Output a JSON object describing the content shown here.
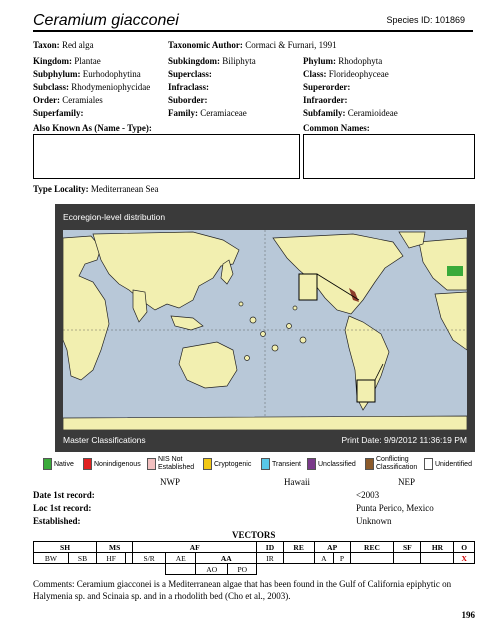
{
  "header": {
    "title": "Ceramium giacconei",
    "species_id": "Species ID: 101869"
  },
  "taxon": {
    "taxon_label": "Taxon:",
    "taxon_value": "Red alga",
    "author_label": "Taxonomic Author:",
    "author_value": "Cormaci & Furnari, 1991"
  },
  "classification": {
    "kingdom_label": "Kingdom:",
    "kingdom_value": "Plantae",
    "subkingdom_label": "Subkingdom:",
    "subkingdom_value": "Biliphyta",
    "phylum_label": "Phylum:",
    "phylum_value": "Rhodophyta",
    "subphylum_label": "Subphylum:",
    "subphylum_value": "Eurhodophytina",
    "superclass_label": "Superclass:",
    "superclass_value": "",
    "class_label": "Class:",
    "class_value": "Florideophyceae",
    "subclass_label": "Subclass:",
    "subclass_value": "Rhodymeniophycidae",
    "infraclass_label": "Infraclass:",
    "infraclass_value": "",
    "superorder_label": "Superorder:",
    "superorder_value": "",
    "order_label": "Order:",
    "order_value": "Ceramiales",
    "suborder_label": "Suborder:",
    "suborder_value": "",
    "infraorder_label": "Infraorder:",
    "infraorder_value": "",
    "superfamily_label": "Superfamily:",
    "superfamily_value": "",
    "family_label": "Family:",
    "family_value": "Ceramiaceae",
    "subfamily_label": "Subfamily:",
    "subfamily_value": "Ceramioideae"
  },
  "names": {
    "aka_label": "Also Known As (Name - Type):",
    "common_label": "Common Names:"
  },
  "type_locality": {
    "label": "Type Locality:",
    "value": "Mediterranean Sea"
  },
  "map": {
    "heading": "Ecoregion-level distribution",
    "footer_left": "Master Classifications",
    "footer_right": "Print Date: 9/9/2012 11:36:19 PM",
    "colors": {
      "frame": "#3a3a3a",
      "ocean": "#b8c8d8",
      "land": "#f2efb0",
      "highlight": "#8b3d2a",
      "native": "#3aaa3a"
    }
  },
  "legend": [
    {
      "label": "Native",
      "color": "#3aaa3a"
    },
    {
      "label": "Nonindigenous",
      "color": "#e02020"
    },
    {
      "label": "NIS Not",
      "label2": "Established",
      "color": "#f2c0c0"
    },
    {
      "label": "Cryptogenic",
      "color": "#f2c814"
    },
    {
      "label": "Transient",
      "color": "#58c8e8"
    },
    {
      "label": "Unclassified",
      "color": "#7a3a8a"
    },
    {
      "label": "Conflicting",
      "label2": "Classification",
      "color": "#8b5a2b"
    },
    {
      "label": "Unidentified",
      "color": "#ffffff"
    }
  ],
  "regions": {
    "nwp": "NWP",
    "hawaii": "Hawaii",
    "nep": "NEP"
  },
  "records": {
    "date_label": "Date 1st record:",
    "date_value": "<2003",
    "loc_label": "Loc 1st record:",
    "loc_value": "Punta Perico, Mexico",
    "est_label": "Established:",
    "est_value": "Unknown"
  },
  "vectors": {
    "title": "VECTORS",
    "row1": [
      "SH",
      "MS",
      "AF",
      "ID",
      "RE",
      "AP",
      "REC",
      "SF",
      "HR",
      "O"
    ],
    "row2": [
      "BW",
      "SB",
      "HF",
      "S/R",
      "AE",
      "AA",
      "IR",
      "A",
      "P",
      "X"
    ],
    "row3": [
      "AO",
      "PO"
    ]
  },
  "comments": "Comments: Ceramium giacconei is a Mediterranean algae that has been found in the Gulf of California epiphytic on Halymenia sp. and Scinaia sp. and in a rhodolith bed (Cho et al., 2003).",
  "page_number": "196"
}
